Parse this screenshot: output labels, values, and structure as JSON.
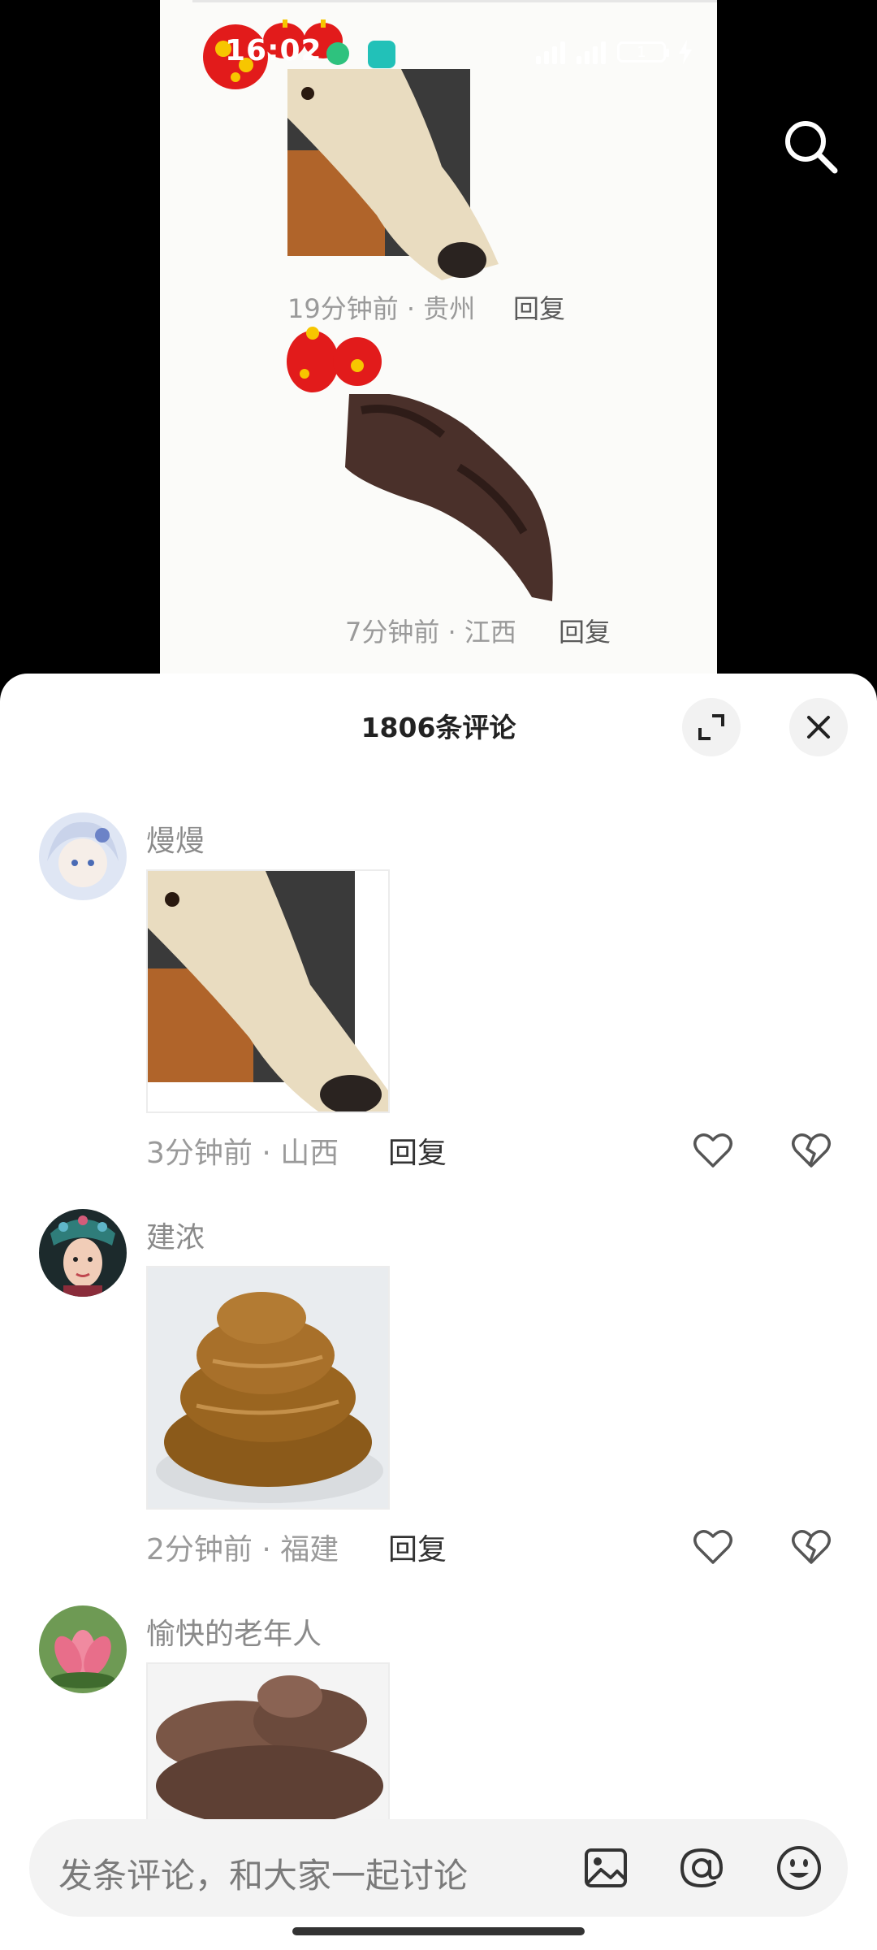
{
  "status_bar": {
    "time": "16:02",
    "battery": "1"
  },
  "video_overlay": {
    "comment1": {
      "meta": "19分钟前 · 贵州",
      "reply": "回复"
    },
    "comment2": {
      "meta": "7分钟前 · 江西",
      "reply": "回复"
    }
  },
  "sheet": {
    "title": "1806条评论"
  },
  "comments": [
    {
      "username": "熳熳",
      "meta": "3分钟前 · 山西",
      "reply": "回复"
    },
    {
      "username": "建浓",
      "meta": "2分钟前 · 福建",
      "reply": "回复"
    },
    {
      "username": "愉快的老年人"
    }
  ],
  "input": {
    "placeholder": "发条评论，和大家一起讨论"
  },
  "icons": [
    "search-icon",
    "expand-icon",
    "close-icon",
    "heart-icon",
    "broken-heart-icon",
    "image-icon",
    "at-icon",
    "emoji-icon"
  ],
  "colors": {
    "sheet_bg": "#ffffff",
    "meta_gray": "#9a9a9a",
    "input_bg": "#f3f3f3"
  }
}
